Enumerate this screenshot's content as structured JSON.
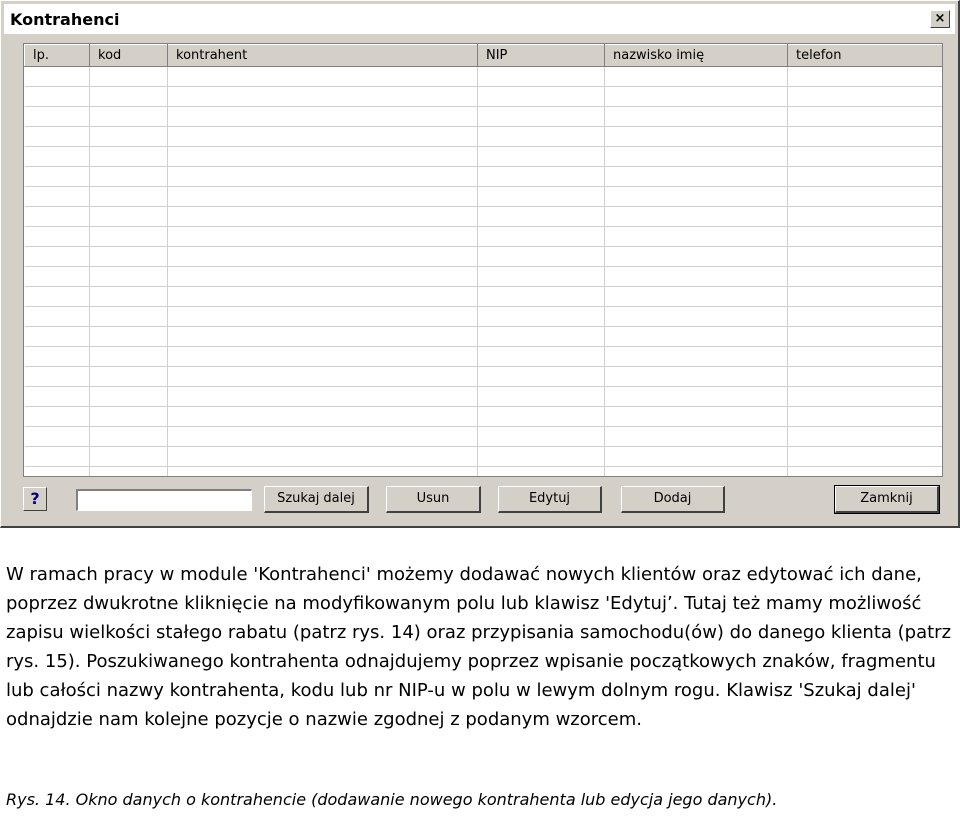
{
  "window": {
    "title": "Kontrahenci",
    "close_label": "×"
  },
  "grid": {
    "columns": [
      "lp.",
      "kod",
      "kontrahent",
      "NIP",
      "nazwisko imię",
      "telefon"
    ],
    "empty_row_count": 21
  },
  "toolbar": {
    "help_label": "?",
    "search_value": "",
    "search_next_label": "Szukaj dalej",
    "delete_label": "Usun",
    "edit_label": "Edytuj",
    "add_label": "Dodaj",
    "close_label": "Zamknij"
  },
  "body_text": "W ramach pracy w module 'Kontrahenci' możemy dodawać nowych klientów oraz edytować ich dane, poprzez dwukrotne kliknięcie na modyfikowanym polu lub klawisz 'Edytuj’. Tutaj też mamy możliwość zapisu wielkości stałego rabatu (patrz rys. 14) oraz przypisania samochodu(ów) do danego klienta (patrz rys. 15). Poszukiwanego kontrahenta odnajdujemy poprzez wpisanie początkowych znaków, fragmentu lub całości nazwy kontrahenta, kodu lub nr NIP-u w polu w lewym dolnym rogu. Klawisz 'Szukaj dalej' odnajdzie nam kolejne pozycje o nazwie zgodnej z podanym wzorcem.",
  "caption": "Rys. 14. Okno danych o kontrahencie (dodawanie nowego kontrahenta lub edycja jego danych)."
}
